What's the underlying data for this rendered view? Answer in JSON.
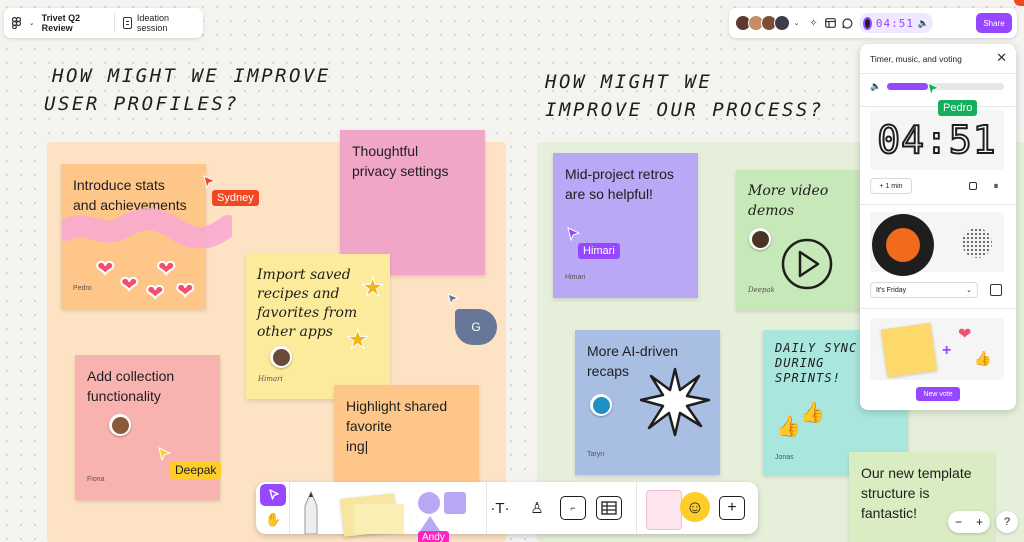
{
  "file": {
    "name": "Trivet Q2 Review",
    "page": "Ideation session"
  },
  "header": {
    "timer": "04:51",
    "share_label": "Share"
  },
  "headings": {
    "left_line1": "How might we improve",
    "left_line2": "user profiles?",
    "right_line1": "How might we",
    "right_line2": "improve our process?"
  },
  "stickies": {
    "s1": {
      "text_line1": "Introduce stats",
      "text_line2": "and achievements",
      "author": "Pedro",
      "color": "#ffc68a"
    },
    "s2": {
      "text_line1": "Thoughtful",
      "text_line2": "privacy settings",
      "color": "#f0a6c7"
    },
    "s3": {
      "text_line1": "Import saved",
      "text_line2": "recipes and",
      "text_line3": "favorites from",
      "text_line4": "other apps",
      "author": "Himari",
      "color": "#fdeb9c"
    },
    "s4": {
      "text_line1": "Add collection",
      "text_line2": "functionality",
      "author": "Fiona",
      "color": "#f8b3b0"
    },
    "s5": {
      "text_line1": "Highlight shared",
      "text_line2": "favorite",
      "text_line3": "ing|",
      "color": "#ffc68a"
    },
    "s6": {
      "text_line1": "Mid-project retros",
      "text_line2": "are so helpful!",
      "author": "Himari",
      "color": "#b8a8f5"
    },
    "s7": {
      "text_line1": "More video",
      "text_line2": "demos",
      "author": "Deepak",
      "color": "#c7e8b8"
    },
    "s8": {
      "text_line1": "More AI-driven",
      "text_line2": "recaps",
      "author": "Taryn",
      "color": "#a8bfe3"
    },
    "s9": {
      "text_line1": "Daily sync",
      "text_line2": "during",
      "text_line3": "sprints!",
      "author": "Jonas",
      "color": "#a8e6de"
    },
    "s10": {
      "text_line1": "Our new template",
      "text_line2": "structure is",
      "text_line3": "fantastic!",
      "color": "#d9ecc2"
    }
  },
  "cursors": {
    "sydney": {
      "name": "Sydney",
      "color": "#f24822"
    },
    "himari": {
      "name": "Himari",
      "color": "#9747ff"
    },
    "deepak": {
      "name": "Deepak",
      "color": "#ffcd29"
    },
    "pedro": {
      "name": "Pedro",
      "color": "#14ae5c"
    },
    "andy": {
      "name": "Andy",
      "color": "#ff24bd"
    },
    "guest": {
      "initial": "G",
      "color": "#667799"
    }
  },
  "panel": {
    "title": "Timer, music, and voting",
    "timer": "04:51",
    "add_minute_label": "+ 1 min",
    "track": "It's Friday",
    "new_vote_label": "New vote",
    "volume_fraction": 0.35
  },
  "zoom": {
    "minus": "−",
    "plus": "+",
    "help": "?"
  },
  "icons": [
    "figma-icon",
    "chevron-down-icon",
    "page-icon",
    "sparkle-icon",
    "layout-icon",
    "comment-icon",
    "speaker-icon",
    "close-icon",
    "cursor-icon",
    "hand-icon",
    "pen-icon",
    "text-icon",
    "stamp-icon",
    "section-icon",
    "table-icon",
    "plus-icon"
  ]
}
